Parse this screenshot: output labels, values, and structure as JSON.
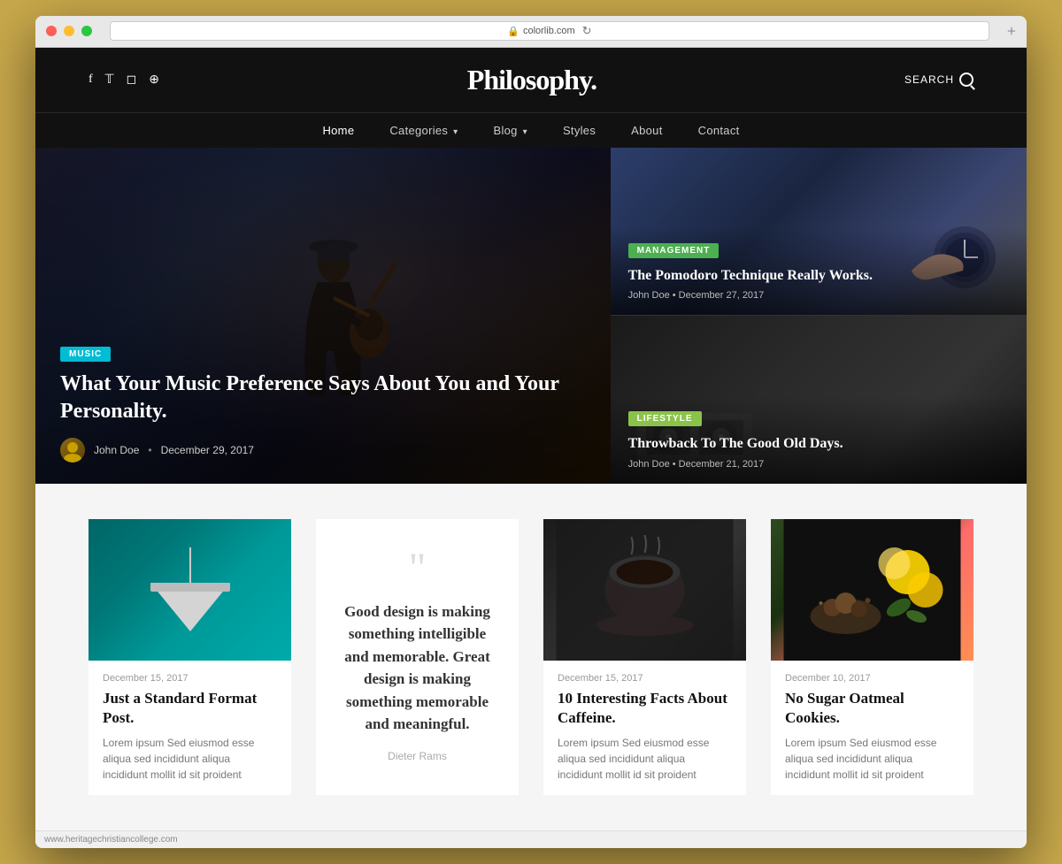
{
  "browser": {
    "url": "colorlib.com",
    "new_tab_label": "+"
  },
  "site": {
    "logo": "Philosophy.",
    "search_label": "SEARCH",
    "social_links": [
      "f",
      "𝕏",
      "📷",
      "⊕"
    ],
    "nav_items": [
      {
        "label": "Home",
        "active": true,
        "has_arrow": false
      },
      {
        "label": "Categories",
        "active": false,
        "has_arrow": true
      },
      {
        "label": "Blog",
        "active": false,
        "has_arrow": true
      },
      {
        "label": "Styles",
        "active": false,
        "has_arrow": false
      },
      {
        "label": "About",
        "active": false,
        "has_arrow": false
      },
      {
        "label": "Contact",
        "active": false,
        "has_arrow": false
      }
    ]
  },
  "hero": {
    "main": {
      "tag": "MUSIC",
      "title": "What Your Music Preference Says About You and Your Personality.",
      "author": "John Doe",
      "date": "December 29, 2017"
    },
    "card1": {
      "tag": "MANAGEMENT",
      "title": "The Pomodoro Technique Really Works.",
      "author": "John Doe",
      "date": "December 27, 2017"
    },
    "card2": {
      "tag": "LIFESTYLE",
      "title": "Throwback To The Good Old Days.",
      "author": "John Doe",
      "date": "December 21, 2017"
    }
  },
  "posts": {
    "post1": {
      "date": "December 15, 2017",
      "title": "Just a Standard Format Post.",
      "excerpt": "Lorem ipsum Sed eiusmod esse aliqua sed incididunt aliqua incididunt mollit id sit proident"
    },
    "quote": {
      "text": "Good design is making something intelligible and memorable. Great design is making something memorable and meaningful.",
      "author": "Dieter Rams"
    },
    "post2": {
      "date": "December 15, 2017",
      "title": "10 Interesting Facts About Caffeine.",
      "excerpt": "Lorem ipsum Sed eiusmod esse aliqua sed incididunt aliqua incididunt mollit id sit proident"
    },
    "post3": {
      "date": "December 10, 2017",
      "title": "No Sugar Oatmeal Cookies.",
      "excerpt": "Lorem ipsum Sed eiusmod esse aliqua sed incididunt aliqua incididunt mollit id sit proident"
    }
  },
  "status_bar": {
    "url": "www.heritagechristiancollege.com"
  },
  "colors": {
    "header_bg": "#111111",
    "accent_music": "#00bcd4",
    "accent_management": "#4caf50",
    "accent_lifestyle": "#8bc34a",
    "body_bg": "#f5f5f5"
  }
}
